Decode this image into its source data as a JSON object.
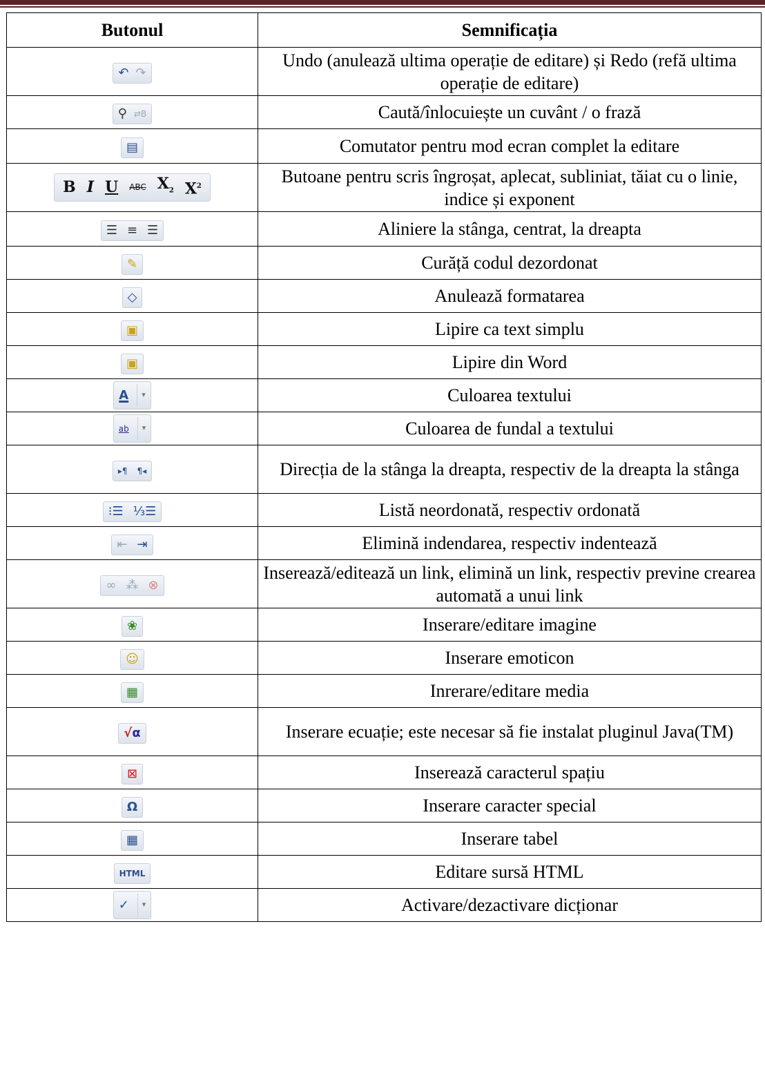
{
  "table": {
    "header": {
      "col1": "Butonul",
      "col2": "Semnificația"
    },
    "rows": [
      {
        "icons": [
          "undo-icon",
          "redo-icon"
        ],
        "text": "Undo (anulează ultima operație de editare) și Redo (refă ultima operație de editare)"
      },
      {
        "icons": [
          "binoculars-icon",
          "replace-icon"
        ],
        "text": "Caută/înlocuiește un cuvânt / o frază"
      },
      {
        "icons": [
          "fullscreen-icon"
        ],
        "text": "Comutator pentru mod ecran complet la editare"
      },
      {
        "icons": [
          "bold-icon",
          "italic-icon",
          "underline-icon",
          "strikethrough-icon",
          "subscript-icon",
          "superscript-icon"
        ],
        "text": "Butoane pentru scris îngroșat, aplecat, subliniat, tăiat cu o linie, indice și exponent"
      },
      {
        "icons": [
          "align-left-icon",
          "align-center-icon",
          "align-right-icon"
        ],
        "text": "Aliniere la stânga, centrat, la dreapta"
      },
      {
        "icons": [
          "broom-icon"
        ],
        "text": "Curăță codul dezordonat"
      },
      {
        "icons": [
          "eraser-icon"
        ],
        "text": "Anulează formatarea"
      },
      {
        "icons": [
          "paste-text-icon"
        ],
        "text": "Lipire ca text simplu"
      },
      {
        "icons": [
          "paste-word-icon"
        ],
        "text": "Lipire din Word"
      },
      {
        "icons": [
          "text-color-icon"
        ],
        "text": "Culoarea textului"
      },
      {
        "icons": [
          "highlight-color-icon"
        ],
        "text": "Culoarea de fundal a textului"
      },
      {
        "icons": [
          "ltr-icon",
          "rtl-icon"
        ],
        "text": "Direcția de la stânga la dreapta, respectiv de la dreapta la stânga"
      },
      {
        "icons": [
          "bullet-list-icon",
          "numbered-list-icon"
        ],
        "text": "Listă neordonată, respectiv ordonată"
      },
      {
        "icons": [
          "outdent-icon",
          "indent-icon"
        ],
        "text": "Elimină indendarea, respectiv indentează"
      },
      {
        "icons": [
          "link-icon",
          "unlink-icon",
          "nolink-icon"
        ],
        "text": "Inserează/editează un link, elimină un link, respectiv previne crearea automată a unui link"
      },
      {
        "icons": [
          "image-icon"
        ],
        "text": "Inserare/editare imagine"
      },
      {
        "icons": [
          "emoticon-icon"
        ],
        "text": "Inserare emoticon"
      },
      {
        "icons": [
          "media-icon"
        ],
        "text": "Inrerare/editare media"
      },
      {
        "icons": [
          "equation-icon"
        ],
        "text": "Inserare ecuație; este necesar să fie instalat pluginul Java(TM)"
      },
      {
        "icons": [
          "nbsp-icon"
        ],
        "text": "Inserează caracterul spațiu"
      },
      {
        "icons": [
          "omega-icon"
        ],
        "text": "Inserare caracter special"
      },
      {
        "icons": [
          "table-icon"
        ],
        "text": "Inserare tabel"
      },
      {
        "icons": [
          "html-source-icon"
        ],
        "text": "Editare sursă HTML"
      },
      {
        "icons": [
          "spellcheck-icon"
        ],
        "text": "Activare/dezactivare dicționar"
      }
    ]
  },
  "glyphs": {
    "html_label": "HTML",
    "abc_label": "ABC",
    "ab_label": "ab"
  }
}
